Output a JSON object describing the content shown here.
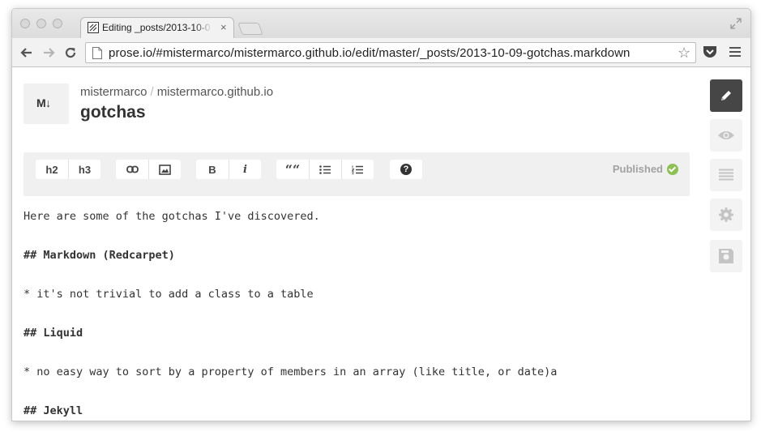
{
  "browser": {
    "tab_title": "Editing _posts/2013-10-0",
    "tab_close": "×",
    "url": "prose.io/#mistermarco/mistermarco.github.io/edit/master/_posts/2013-10-09-gotchas.markdown",
    "star_glyph": "☆"
  },
  "header": {
    "badge": "M↓",
    "user": "mistermarco",
    "separator": "/",
    "repo": "mistermarco.github.io",
    "title": "gotchas"
  },
  "toolbar": {
    "h2": "h2",
    "h3": "h3",
    "bold": "B",
    "italic": "i",
    "quote": "““",
    "help": "?",
    "status": "Published"
  },
  "content": {
    "lines": [
      "Here are some of the gotchas I've discovered.",
      "## Markdown (Redcarpet)",
      "* it's not trivial to add a class to a table",
      "## Liquid",
      "* no easy way to sort by a property of members in an array (like title, or date)a",
      "## Jekyll"
    ]
  },
  "sidebar": {
    "active": "edit",
    "items": [
      "pencil-icon",
      "eye-icon",
      "list-icon",
      "gear-icon",
      "save-icon"
    ]
  },
  "colors": {
    "published_check": "#8cc152",
    "active_sidebar": "#464646"
  }
}
